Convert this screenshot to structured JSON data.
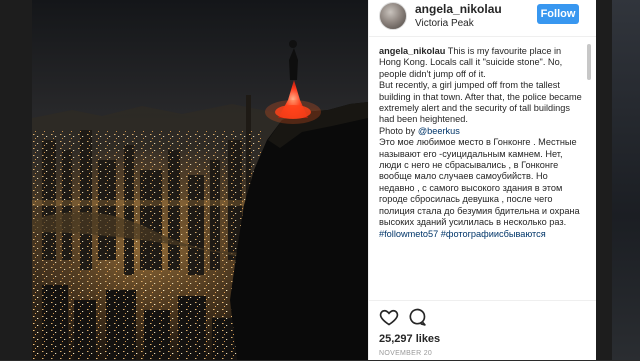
{
  "post": {
    "username": "angela_nikolau",
    "location": "Victoria Peak",
    "follow_label": "Follow",
    "caption": {
      "author": "angela_nikolau",
      "text_en_1": " This is my favourite place in Hong Kong. Locals call it \"suicide stone\". No, people didn't jump off of it.\nBut recently, a girl jumped off from the tallest building in that town. After that, the police became extremely alert and the security of tall buildings had been heightened.\nPhoto by ",
      "photo_credit": "@beerkus",
      "text_ru": "\nЭто мое любимое место в Гонконге . Местные называют его -суицидальным камнем. Нет, люди с него не сбрасывались , в Гонконге вообще мало случаев самоубийств. Но недавно , с самого высокого здания в этом городе сбросилась девушка , после чего полиция стала до безумия бдительна и охрана высоких зданий усилилась в несколько раз.",
      "hashtags": "#followmeto57 #фотографиисбываются"
    },
    "likes": "25,297 likes",
    "date": "NOVEMBER 20"
  },
  "colors": {
    "follow_button": "#3897f0",
    "link": "#003569"
  },
  "icons": [
    "heart-icon",
    "comment-icon"
  ]
}
